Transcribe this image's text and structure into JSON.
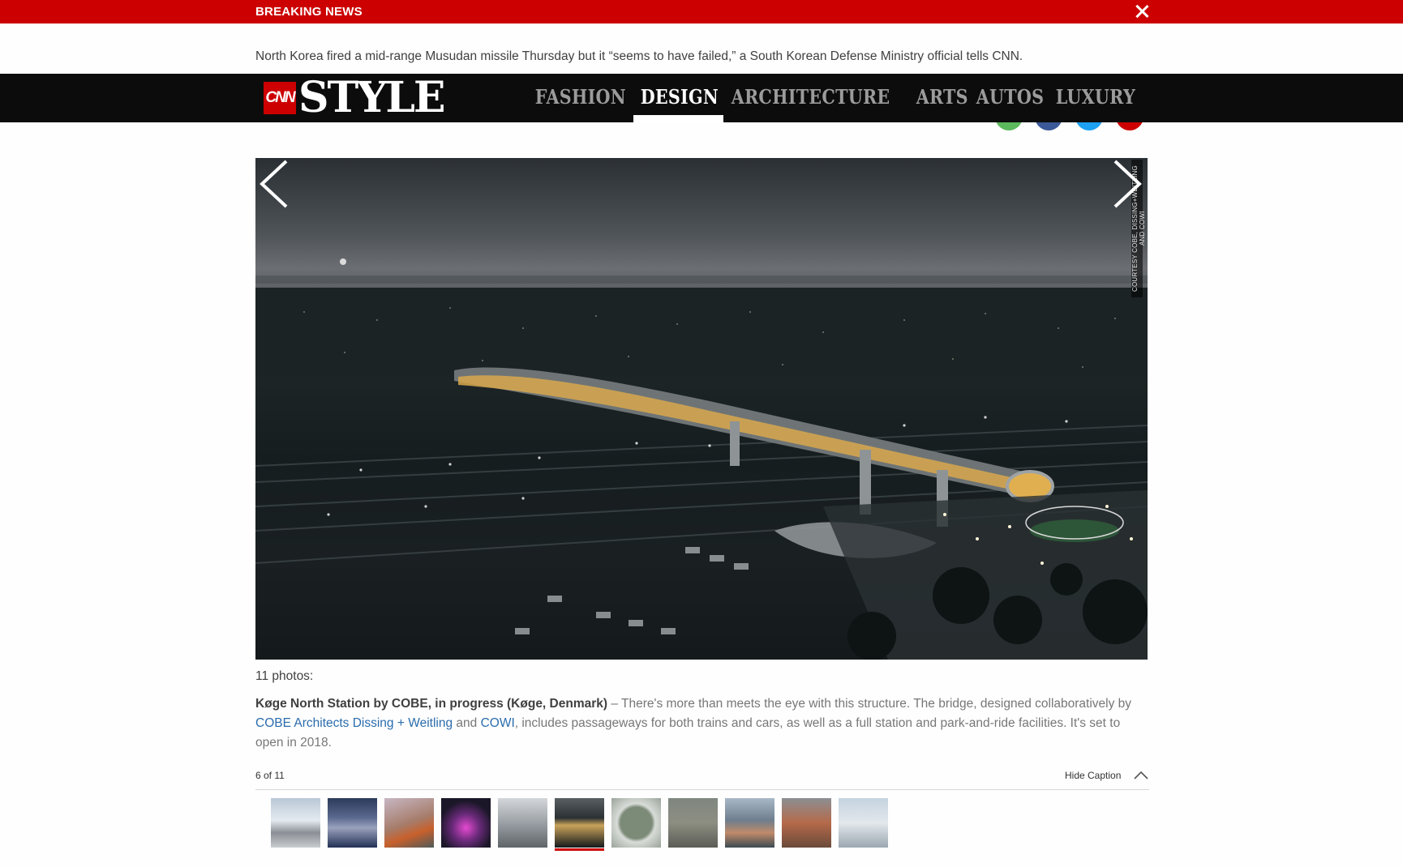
{
  "breaking": {
    "label": "BREAKING NEWS",
    "text": "North Korea fired a mid-range Musudan missile Thursday but it “seems to have failed,” a South Korean Defense Ministry official tells CNN."
  },
  "nav": {
    "logo_cnn": "CNN",
    "logo_style": "STYLE",
    "items": [
      {
        "label": "FASHION"
      },
      {
        "label": "DESIGN"
      },
      {
        "label": "ARCHITECTURE"
      },
      {
        "label": "ARTS"
      },
      {
        "label": "AUTOS"
      },
      {
        "label": "LUXURY"
      }
    ],
    "active": "DESIGN"
  },
  "share": {
    "colors": [
      "#5cb85c",
      "#3b5998",
      "#1da1f2",
      "#cc0000"
    ]
  },
  "gallery": {
    "credit": "COURTESY COBE, DISSING+WEITLING AND COWI",
    "photo_count": "11 photos:",
    "caption": {
      "title": "Køge North Station by COBE, in progress (Køge, Denmark)",
      "dash": " – ",
      "text_1": "There's more than meets the eye with this structure. The bridge, designed collaboratively by ",
      "link_1": "COBE Architects Dissing + Weitling",
      "text_2": " and ",
      "link_2": "COWI",
      "text_3": ", includes passageways for both trains and cars, as well as a full station and park-and-ride facilities. It's set to open in 2018."
    },
    "position": "6 of 11",
    "hide_caption": "Hide Caption",
    "current_index": 6,
    "thumbnails": [
      {
        "bg": "linear-gradient(180deg,#b9c8d6 0%,#e4eaf0 45%,#8a8f95 70%,#c9ccd0 100%)"
      },
      {
        "bg": "linear-gradient(180deg,#2c3a5a 0%,#5b6a90 40%,#9aa2bd 60%,#233055 100%)"
      },
      {
        "bg": "linear-gradient(160deg,#c7b7c3 0%,#a67c6a 50%,#c8602c 70%,#4d5b5a 100%)"
      },
      {
        "bg": "radial-gradient(circle at 50% 60%,#e44ad0 0%,#6a2a7a 35%,#1b1728 70%)"
      },
      {
        "bg": "linear-gradient(180deg,#d4d7da 0%,#9aa0a5 50%,#5f6468 100%)"
      },
      {
        "bg": "linear-gradient(180deg,#5a5f63 0%,#2a3033 40%,#caa35a 55%,#141a1c 100%)"
      },
      {
        "bg": "radial-gradient(circle at 50% 50%,#7c8a78 0%,#7c8a78 45%,#d8dcd8 55%,#9aa39a 100%)"
      },
      {
        "bg": "linear-gradient(180deg,#7f8780 0%,#8d8e82 50%,#5b5c55 100%)"
      },
      {
        "bg": "linear-gradient(180deg,#a9b8c7 0%,#6e7e8d 45%,#c08a6a 70%,#3c4a52 100%)"
      },
      {
        "bg": "linear-gradient(180deg,#8b8f93 0%,#b56a4a 50%,#6a4a3a 100%)"
      },
      {
        "bg": "linear-gradient(180deg,#c5d3df 0%,#e3e8ec 50%,#9ba7b1 100%)"
      }
    ]
  }
}
